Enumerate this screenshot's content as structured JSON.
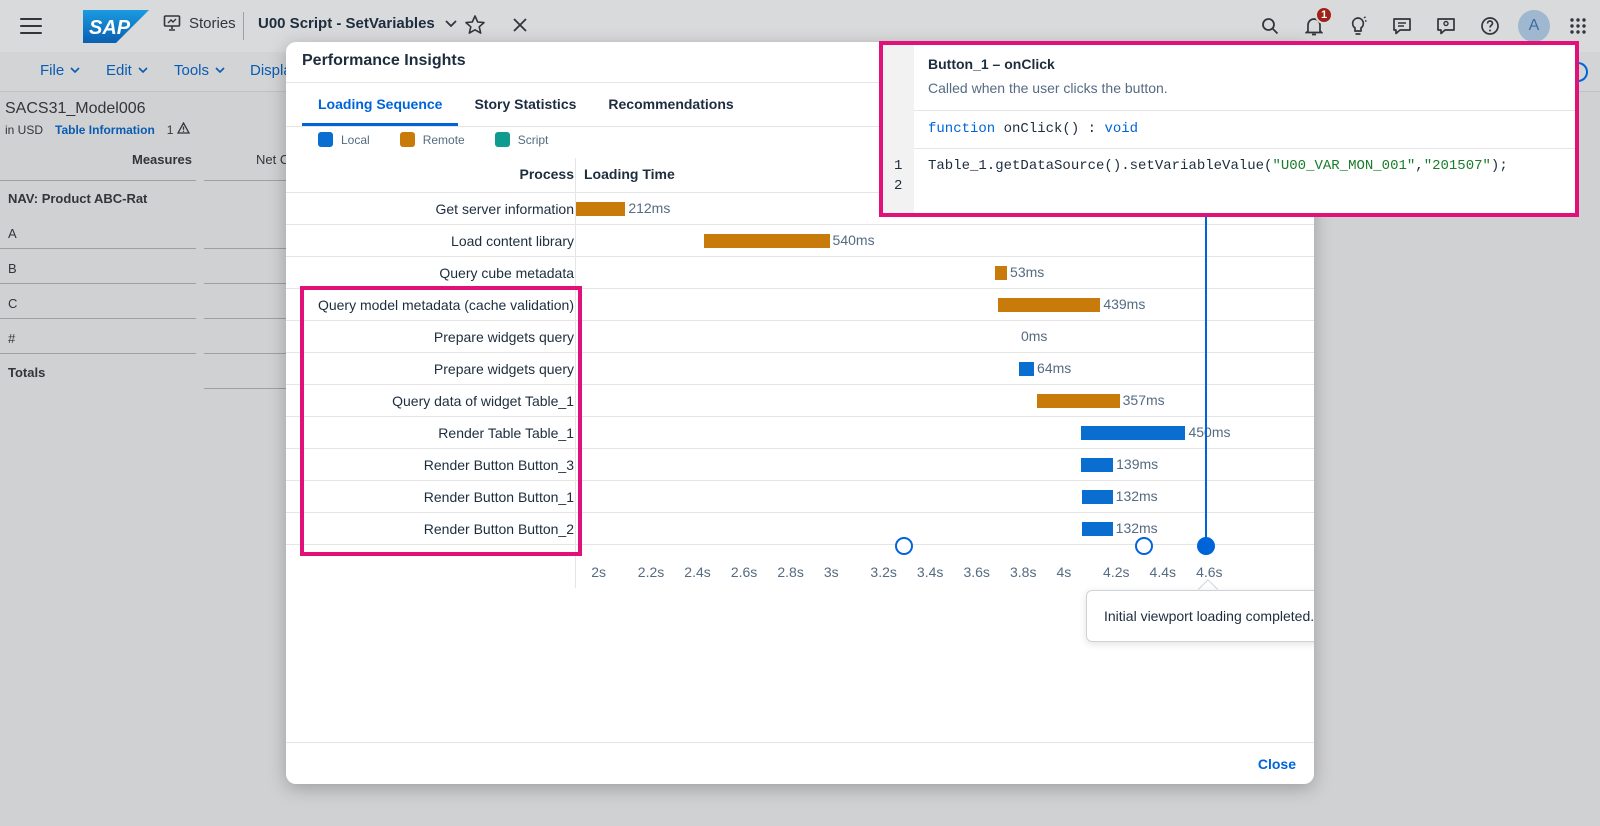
{
  "shell": {
    "logo_text": "SAP",
    "stories_label": "Stories",
    "story_title": "U00 Script - SetVariables",
    "notification_count": "1",
    "avatar_initial": "A"
  },
  "toolbar": {
    "menus": [
      "File",
      "Edit",
      "Tools",
      "Displa"
    ]
  },
  "background": {
    "model_name": "SACS31_Model006",
    "currency": "in USD",
    "table_info": "Table Information",
    "warning_count": "1",
    "measures_header": "Measures",
    "net_header": "Net C",
    "rows": [
      "NAV: Product ABC-Rat",
      "A",
      "B",
      "C",
      "#",
      "Totals"
    ]
  },
  "dialog": {
    "title": "Performance Insights",
    "tabs": [
      "Loading Sequence",
      "Story Statistics",
      "Recommendations"
    ],
    "active_tab": 0,
    "legend": [
      {
        "label": "Local",
        "color": "#0a6ed1"
      },
      {
        "label": "Remote",
        "color": "#c87b0a"
      },
      {
        "label": "Script",
        "color": "#0f9b8e"
      }
    ],
    "process_header": "Process",
    "time_header": "Loading Time",
    "close_label": "Close",
    "tooltip": "Initial viewport loading completed."
  },
  "chart_data": {
    "type": "gantt",
    "x_unit": "s",
    "xlim": [
      1.9,
      4.72
    ],
    "ticks": [
      "2s",
      "2.2s",
      "2.4s",
      "2.6s",
      "2.8s",
      "3s",
      "3.2s",
      "3.4s",
      "3.6s",
      "3.8s",
      "4s",
      "4.2s",
      "4.4s",
      "4.6s"
    ],
    "tasks": [
      {
        "process": "Get server information",
        "start": 1.9,
        "duration_ms": 212,
        "type": "Remote",
        "label": "212ms"
      },
      {
        "process": "Load content library",
        "start": 2.45,
        "duration_ms": 540,
        "type": "Remote",
        "label": "540ms"
      },
      {
        "process": "Query cube metadata",
        "start": 3.7,
        "duration_ms": 53,
        "type": "Remote",
        "label": "53ms"
      },
      {
        "process": "Query model metadata (cache validation)",
        "start": 3.715,
        "duration_ms": 439,
        "type": "Remote",
        "label": "439ms"
      },
      {
        "process": "Prepare widgets query",
        "start": 3.8,
        "duration_ms": 0,
        "type": "Local",
        "label": "0ms"
      },
      {
        "process": "Prepare widgets query",
        "start": 3.805,
        "duration_ms": 64,
        "type": "Local",
        "label": "64ms"
      },
      {
        "process": "Query data of widget Table_1",
        "start": 3.88,
        "duration_ms": 357,
        "type": "Remote",
        "label": "357ms"
      },
      {
        "process": "Render Table Table_1",
        "start": 4.07,
        "duration_ms": 450,
        "type": "Local",
        "label": "450ms"
      },
      {
        "process": "Render Button Button_3",
        "start": 4.07,
        "duration_ms": 139,
        "type": "Local",
        "label": "139ms"
      },
      {
        "process": "Render Button Button_1",
        "start": 4.075,
        "duration_ms": 132,
        "type": "Local",
        "label": "132ms"
      },
      {
        "process": "Render Button Button_2",
        "start": 4.075,
        "duration_ms": 132,
        "type": "Local",
        "label": "132ms"
      }
    ],
    "markers": [
      {
        "time": 3.31,
        "filled": false
      },
      {
        "time": 4.34,
        "filled": false
      },
      {
        "time": 4.61,
        "filled": true
      }
    ]
  },
  "code_popover": {
    "title": "Button_1 – onClick",
    "description": "Called when the user clicks the button.",
    "signature_kw": "function",
    "signature_name": " onClick() : ",
    "signature_ret": "void",
    "line_numbers": [
      "1",
      "2"
    ],
    "code_prefix": "Table_1.getDataSource().setVariableValue(",
    "code_arg1": "\"U00_VAR_MON_001\"",
    "code_comma": ",",
    "code_arg2": "\"201507\"",
    "code_suffix": ");"
  },
  "colors": {
    "local": "#0a6ed1",
    "remote": "#c87b0a",
    "script": "#0f9b8e",
    "highlight": "#e0127a",
    "accent": "#0064d9"
  }
}
